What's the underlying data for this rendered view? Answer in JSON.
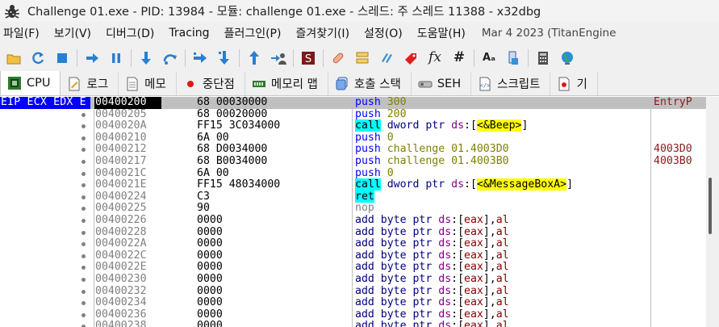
{
  "window": {
    "title": "Challenge 01.exe - PID: 13984 - 모듈: challenge 01.exe - 스레드: 주 스레드 11388 - x32dbg"
  },
  "menu": {
    "items": [
      "파일(F)",
      "보기(V)",
      "디버그(D)",
      "Tracing",
      "플러그인(P)",
      "즐겨찾기(I)",
      "설정(O)",
      "도움말(H)"
    ],
    "date": "Mar 4 2023 (TitanEngine"
  },
  "toolbar": {
    "icons": [
      "open-folder-icon",
      "restart-icon",
      "stop-icon",
      "run-icon",
      "pause-icon",
      "step-into-icon",
      "step-over-icon",
      "trace-into-icon",
      "trace-over-icon",
      "execute-till-return-icon",
      "run-to-user-code-icon",
      "scylla-icon",
      "patch-icon",
      "comment-icon",
      "bookmark-icon",
      "label-icon",
      "function-icon",
      "hash-icon",
      "font-size-icon",
      "memory-map-icon",
      "calculator-icon",
      "globe-icon"
    ]
  },
  "tabs": [
    {
      "label": "CPU",
      "icon": "cpu-icon",
      "active": true
    },
    {
      "label": "로그",
      "icon": "log-icon"
    },
    {
      "label": "메모",
      "icon": "notes-icon"
    },
    {
      "label": "중단점",
      "icon": "breakpoint-icon"
    },
    {
      "label": "메모리 맵",
      "icon": "memory-map-tab-icon"
    },
    {
      "label": "호출 스택",
      "icon": "call-stack-icon"
    },
    {
      "label": "SEH",
      "icon": "seh-icon"
    },
    {
      "label": "스크립트",
      "icon": "script-icon"
    },
    {
      "label": "기",
      "icon": "symbols-icon"
    }
  ],
  "disasm": {
    "register_label": "EIP ECX EDX E",
    "rows": [
      {
        "addr": "00400200",
        "bytes": "68 00030000",
        "mnemonic": "push",
        "kind": "push",
        "ops": [
          [
            "300",
            "num"
          ]
        ],
        "comment": "EntryP",
        "current": true
      },
      {
        "addr": "00400205",
        "bytes": "68 00020000",
        "mnemonic": "push",
        "kind": "push",
        "ops": [
          [
            "200",
            "num"
          ]
        ],
        "comment": ""
      },
      {
        "addr": "0040020A",
        "bytes": "FF15 3C034000",
        "mnemonic": "call",
        "kind": "call",
        "ops": [
          [
            "dword ptr ",
            "kw"
          ],
          [
            "ds",
            "seg"
          ],
          [
            ":[",
            "brk"
          ],
          [
            "<&Beep>",
            "lbl"
          ],
          [
            "]",
            "brk"
          ]
        ],
        "comment": ""
      },
      {
        "addr": "00400210",
        "bytes": "6A 00",
        "mnemonic": "push",
        "kind": "push",
        "ops": [
          [
            "0",
            "num"
          ]
        ],
        "comment": ""
      },
      {
        "addr": "00400212",
        "bytes": "68 D0034000",
        "mnemonic": "push",
        "kind": "push",
        "ops": [
          [
            "challenge 01.4003D0",
            "sym"
          ]
        ],
        "comment": "4003D0"
      },
      {
        "addr": "00400217",
        "bytes": "68 B0034000",
        "mnemonic": "push",
        "kind": "push",
        "ops": [
          [
            "challenge 01.4003B0",
            "sym"
          ]
        ],
        "comment": "4003B0"
      },
      {
        "addr": "0040021C",
        "bytes": "6A 00",
        "mnemonic": "push",
        "kind": "push",
        "ops": [
          [
            "0",
            "num"
          ]
        ],
        "comment": ""
      },
      {
        "addr": "0040021E",
        "bytes": "FF15 48034000",
        "mnemonic": "call",
        "kind": "call",
        "ops": [
          [
            "dword ptr ",
            "kw"
          ],
          [
            "ds",
            "seg"
          ],
          [
            ":[",
            "brk"
          ],
          [
            "<&MessageBoxA>",
            "lbl"
          ],
          [
            "]",
            "brk"
          ]
        ],
        "comment": ""
      },
      {
        "addr": "00400224",
        "bytes": "C3",
        "mnemonic": "ret",
        "kind": "ret",
        "ops": [],
        "comment": ""
      },
      {
        "addr": "00400225",
        "bytes": "90",
        "mnemonic": "nop",
        "kind": "nop",
        "ops": [],
        "comment": ""
      },
      {
        "addr": "00400226",
        "bytes": "0000",
        "mnemonic": "add",
        "kind": "add",
        "ops": [
          [
            "byte ptr ",
            "kw"
          ],
          [
            "ds",
            "seg"
          ],
          [
            ":[",
            "brk"
          ],
          [
            "eax",
            "reg"
          ],
          [
            "],",
            "brk"
          ],
          [
            "al",
            "reg"
          ]
        ],
        "comment": ""
      },
      {
        "addr": "00400228",
        "bytes": "0000",
        "mnemonic": "add",
        "kind": "add",
        "ops": [
          [
            "byte ptr ",
            "kw"
          ],
          [
            "ds",
            "seg"
          ],
          [
            ":[",
            "brk"
          ],
          [
            "eax",
            "reg"
          ],
          [
            "],",
            "brk"
          ],
          [
            "al",
            "reg"
          ]
        ],
        "comment": ""
      },
      {
        "addr": "0040022A",
        "bytes": "0000",
        "mnemonic": "add",
        "kind": "add",
        "ops": [
          [
            "byte ptr ",
            "kw"
          ],
          [
            "ds",
            "seg"
          ],
          [
            ":[",
            "brk"
          ],
          [
            "eax",
            "reg"
          ],
          [
            "],",
            "brk"
          ],
          [
            "al",
            "reg"
          ]
        ],
        "comment": ""
      },
      {
        "addr": "0040022C",
        "bytes": "0000",
        "mnemonic": "add",
        "kind": "add",
        "ops": [
          [
            "byte ptr ",
            "kw"
          ],
          [
            "ds",
            "seg"
          ],
          [
            ":[",
            "brk"
          ],
          [
            "eax",
            "reg"
          ],
          [
            "],",
            "brk"
          ],
          [
            "al",
            "reg"
          ]
        ],
        "comment": ""
      },
      {
        "addr": "0040022E",
        "bytes": "0000",
        "mnemonic": "add",
        "kind": "add",
        "ops": [
          [
            "byte ptr ",
            "kw"
          ],
          [
            "ds",
            "seg"
          ],
          [
            ":[",
            "brk"
          ],
          [
            "eax",
            "reg"
          ],
          [
            "],",
            "brk"
          ],
          [
            "al",
            "reg"
          ]
        ],
        "comment": ""
      },
      {
        "addr": "00400230",
        "bytes": "0000",
        "mnemonic": "add",
        "kind": "add",
        "ops": [
          [
            "byte ptr ",
            "kw"
          ],
          [
            "ds",
            "seg"
          ],
          [
            ":[",
            "brk"
          ],
          [
            "eax",
            "reg"
          ],
          [
            "],",
            "brk"
          ],
          [
            "al",
            "reg"
          ]
        ],
        "comment": ""
      },
      {
        "addr": "00400232",
        "bytes": "0000",
        "mnemonic": "add",
        "kind": "add",
        "ops": [
          [
            "byte ptr ",
            "kw"
          ],
          [
            "ds",
            "seg"
          ],
          [
            ":[",
            "brk"
          ],
          [
            "eax",
            "reg"
          ],
          [
            "],",
            "brk"
          ],
          [
            "al",
            "reg"
          ]
        ],
        "comment": ""
      },
      {
        "addr": "00400234",
        "bytes": "0000",
        "mnemonic": "add",
        "kind": "add",
        "ops": [
          [
            "byte ptr ",
            "kw"
          ],
          [
            "ds",
            "seg"
          ],
          [
            ":[",
            "brk"
          ],
          [
            "eax",
            "reg"
          ],
          [
            "],",
            "brk"
          ],
          [
            "al",
            "reg"
          ]
        ],
        "comment": ""
      },
      {
        "addr": "00400236",
        "bytes": "0000",
        "mnemonic": "add",
        "kind": "add",
        "ops": [
          [
            "byte ptr ",
            "kw"
          ],
          [
            "ds",
            "seg"
          ],
          [
            ":[",
            "brk"
          ],
          [
            "eax",
            "reg"
          ],
          [
            "],",
            "brk"
          ],
          [
            "al",
            "reg"
          ]
        ],
        "comment": ""
      },
      {
        "addr": "00400238",
        "bytes": "0000",
        "mnemonic": "add",
        "kind": "add",
        "ops": [
          [
            "byte ptr ",
            "kw"
          ],
          [
            "ds",
            "seg"
          ],
          [
            ":[",
            "brk"
          ],
          [
            "eax",
            "reg"
          ],
          [
            "],",
            "brk"
          ],
          [
            "al",
            "reg"
          ]
        ],
        "comment": ""
      }
    ]
  }
}
